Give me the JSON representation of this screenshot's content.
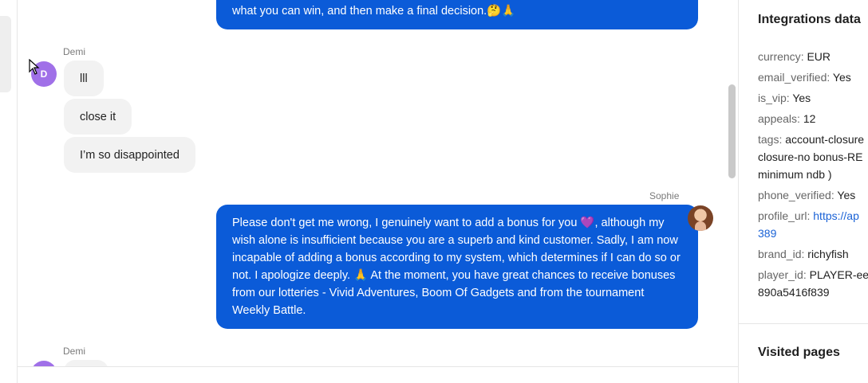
{
  "chat": {
    "agent_top": {
      "text": "what you can win, and then make a final decision.🤔🙏"
    },
    "demi_group_1": {
      "name": "Demi",
      "avatar_letter": "D",
      "messages": [
        "lll",
        "close it",
        "I’m so disappointed"
      ]
    },
    "sophie": {
      "name": "Sophie",
      "message": "Please don't get me wrong, I genuinely want to add a bonus for you 💜, although my wish alone is insufficient because you are a superb and kind customer. Sadly, I am now incapable of adding a bonus according to my system, which determines if I can do so or not. I apologize deeply. 🙏 At the moment, you have great chances to receive bonuses from our lotteries - Vivid Adventures, Boom Of Gadgets and from the tournament Weekly Battle."
    },
    "demi_group_2": {
      "name": "Demi"
    }
  },
  "sidebar": {
    "integrations_title": "Integrations data",
    "fields": {
      "currency": {
        "key": "currency",
        "value": "EUR"
      },
      "email_verified": {
        "key": "email_verified",
        "value": "Yes"
      },
      "is_vip": {
        "key": "is_vip",
        "value": "Yes"
      },
      "appeals": {
        "key": "appeals",
        "value": "12"
      },
      "tags": {
        "key": "tags",
        "value_line1": "account-closure",
        "value_line2": "closure-no bonus-RE",
        "value_line3": "minimum ndb )"
      },
      "phone_verified": {
        "key": "phone_verified",
        "value": "Yes"
      },
      "profile_url": {
        "key": "profile_url",
        "value_line1": "https://ap",
        "value_line2": "389"
      },
      "brand_id": {
        "key": "brand_id",
        "value": "richyfish"
      },
      "player_id": {
        "key": "player_id",
        "value_line1": "PLAYER-ee",
        "value_line2": "890a5416f839"
      }
    },
    "visited_title": "Visited pages"
  },
  "colors": {
    "agent_bubble": "#0b5bd8",
    "user_bubble": "#f2f2f2",
    "avatar_demi": "#a070e8",
    "link": "#1a62d6"
  }
}
